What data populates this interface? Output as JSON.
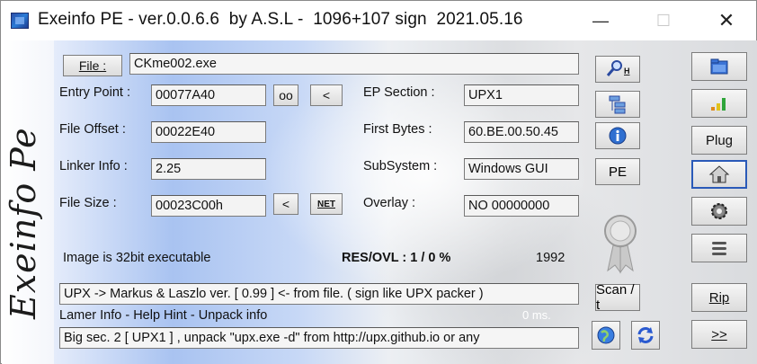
{
  "window": {
    "title": "Exeinfo PE - ver.0.0.6.6  by A.S.L -  1096+107 sign  2021.05.16",
    "controls": {
      "minimize": "—",
      "maximize": "☐",
      "close": "✕"
    }
  },
  "logo": "Exeinfo Pe",
  "file": {
    "button_label": "File :",
    "value": "CKme002.exe"
  },
  "entry_point": {
    "label": "Entry Point :",
    "value": "00077A40",
    "oo_button": "oo",
    "back_button": "<"
  },
  "ep_section": {
    "label": "EP Section :",
    "value": "UPX1"
  },
  "file_offset": {
    "label": "File Offset :",
    "value": "00022E40"
  },
  "first_bytes": {
    "label": "First Bytes :",
    "value": "60.BE.00.50.45"
  },
  "linker_info": {
    "label": "Linker Info :",
    "value": "2.25"
  },
  "subsystem": {
    "label": "SubSystem :",
    "value": "Windows GUI"
  },
  "file_size": {
    "label": "File Size :",
    "value": "00023C00h",
    "back_button": "<",
    "net_button": "NET"
  },
  "overlay": {
    "label": "Overlay :",
    "value": "NO  00000000"
  },
  "status": {
    "image_info": "Image is 32bit executable",
    "res_ovl": "RES/OVL : 1 / 0 %",
    "year": "1992",
    "detection": "UPX -> Markus & Laszlo ver. [ 0.99 ] <- from file. ( sign like UPX packer )",
    "lamer_info": "Lamer Info - Help Hint - Unpack info",
    "timing": "0 ms.",
    "hint": "Big sec. 2 [ UPX1 ] , unpack \"upx.exe -d\"  from  http://upx.github.io or any"
  },
  "middle_buttons": {
    "search_hotkey": "H",
    "pe_button": "PE",
    "scan_button": "Scan / t"
  },
  "right_buttons": {
    "plug_label": "Plug",
    "rip_label": "Rip",
    "next_label": ">>"
  }
}
